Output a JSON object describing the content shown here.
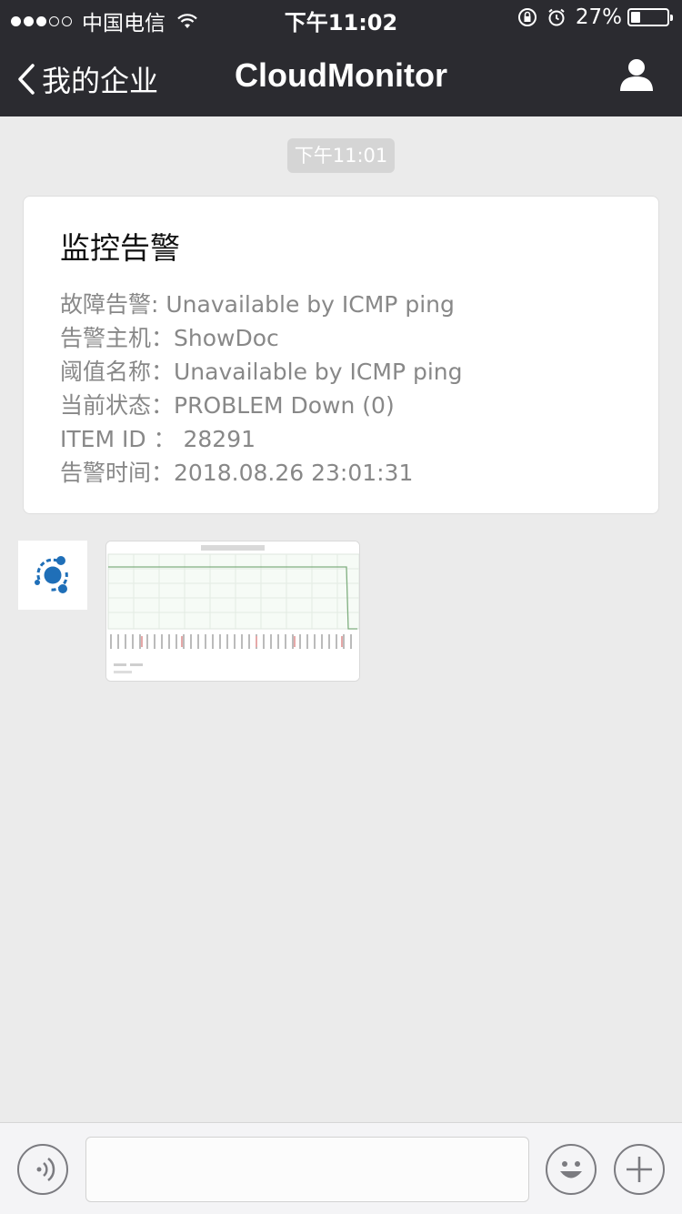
{
  "status_bar": {
    "carrier": "中国电信",
    "time": "下午11:02",
    "battery": "27%",
    "battery_level": 0.27
  },
  "nav": {
    "back_label": "我的企业",
    "title": "CloudMonitor"
  },
  "chat": {
    "timestamp": "下午11:01",
    "card": {
      "title": "监控告警",
      "lines": [
        "故障告警: Unavailable by ICMP ping",
        "告警主机：ShowDoc",
        "阈值名称：Unavailable by ICMP ping",
        "当前状态：PROBLEM Down (0)",
        "ITEM ID ： 28291",
        "告警时间：2018.08.26 23:01:31"
      ]
    }
  },
  "icons": {
    "back": "chevron-left-icon",
    "profile": "person-icon",
    "voice": "voice-icon",
    "emoji": "smiley-icon",
    "plus": "plus-icon",
    "wifi": "wifi-icon",
    "lock": "orientation-lock-icon",
    "alarm": "alarm-icon"
  },
  "colors": {
    "nav_bg": "#2b2b30",
    "chat_bg": "#ebebeb",
    "avatar_blue": "#1f6fb8"
  }
}
